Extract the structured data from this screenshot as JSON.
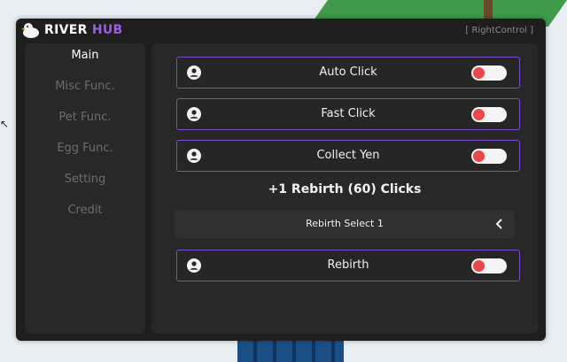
{
  "window": {
    "title_primary": "RIVER",
    "title_accent": "HUB",
    "keybind": "[ RightControl ]",
    "accent_color": "#9b5de5"
  },
  "sidebar": {
    "items": [
      {
        "label": "Main",
        "active": true
      },
      {
        "label": "Misc Func.",
        "active": false
      },
      {
        "label": "Pet Func.",
        "active": false
      },
      {
        "label": "Egg Func.",
        "active": false
      },
      {
        "label": "Setting",
        "active": false
      },
      {
        "label": "Credit",
        "active": false
      }
    ]
  },
  "main": {
    "toggles": [
      {
        "label": "Auto Click",
        "icon": "user-icon",
        "state": "off"
      },
      {
        "label": "Fast Click",
        "icon": "user-icon",
        "state": "off"
      },
      {
        "label": "Collect Yen",
        "icon": "user-icon",
        "state": "off"
      }
    ],
    "rebirth_info": "+1 Rebirth (60) Clicks",
    "rebirth_select": {
      "label": "Rebirth Select 1",
      "icon": "chevron-left-icon"
    },
    "rebirth_toggle": {
      "label": "Rebirth",
      "icon": "user-icon",
      "state": "off"
    }
  },
  "colors": {
    "toggle_off_knob": "#e84848",
    "row_border": "#7d4cc9"
  }
}
